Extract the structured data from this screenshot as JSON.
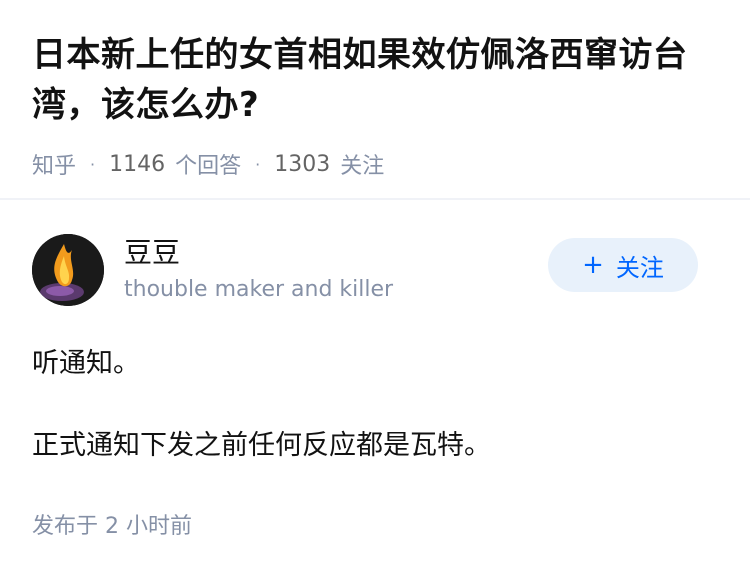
{
  "question": {
    "title": "日本新上任的女首相如果效仿佩洛西窜访台湾，该怎么办?",
    "source": "知乎",
    "answer_count": "1146",
    "answer_label": "个回答",
    "follower_count": "1303",
    "follower_label": "关注"
  },
  "author": {
    "name": "豆豆",
    "bio": "thouble maker and killer",
    "follow_plus": "+",
    "follow_label": "关注"
  },
  "answer": {
    "paragraphs": [
      "听通知。",
      "正式通知下发之前任何反应都是瓦特。"
    ],
    "publish_time": "发布于 2 小时前"
  },
  "colors": {
    "accent": "#0066ff",
    "follow_bg": "#e8f1fb",
    "meta_gray": "#8590a6"
  },
  "icons": {
    "avatar": "fire-avatar-icon"
  }
}
